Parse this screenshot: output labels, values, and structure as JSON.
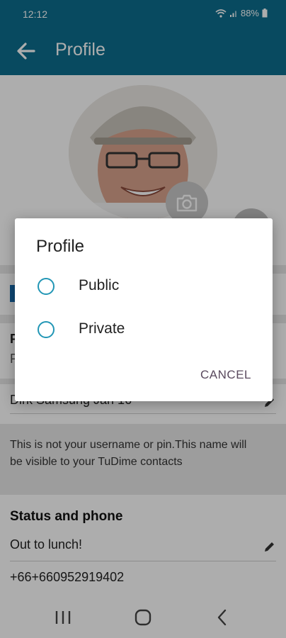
{
  "status_bar": {
    "time": "12:12",
    "battery": "88%"
  },
  "app_bar": {
    "title": "Profile"
  },
  "profile_partial": {
    "label_fragment": "P",
    "value_fragment": "P"
  },
  "name_field": {
    "value": "Dirk Samsung Jan 16"
  },
  "info_text": "This is not your username or pin.This name will be visible to your TuDime contacts",
  "status_section": {
    "title": "Status and phone",
    "status_value": "Out to lunch!",
    "phone": "+66+660952919402"
  },
  "dialog": {
    "title": "Profile",
    "options": [
      {
        "label": "Public"
      },
      {
        "label": "Private"
      }
    ],
    "cancel_label": "CANCEL"
  },
  "icons": {
    "back": "arrow-back-icon",
    "camera": "camera-icon",
    "edit": "pencil-icon"
  },
  "colors": {
    "primary": "#0d6e8e",
    "radio_accent": "#2196b5",
    "cancel_text": "#5a4a5e"
  }
}
